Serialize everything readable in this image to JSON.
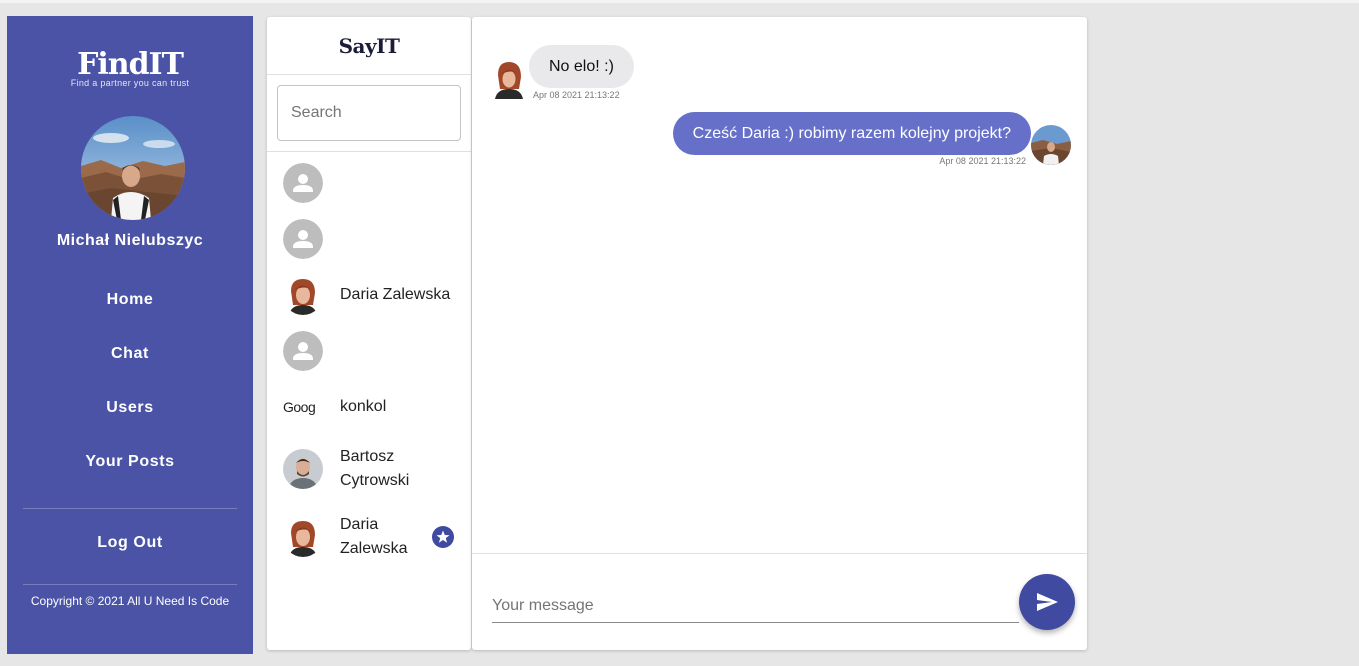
{
  "sidebar": {
    "logo_title": "FindIT",
    "logo_subtitle": "Find a partner you can trust",
    "user_name": "Michał Nielubszyc",
    "nav": [
      {
        "label": "Home"
      },
      {
        "label": "Chat"
      },
      {
        "label": "Users"
      },
      {
        "label": "Your Posts"
      }
    ],
    "logout_label": "Log Out",
    "copyright": "Copyright © 2021 All U Need Is Code",
    "background_color": "#4a53a6"
  },
  "contacts": {
    "app_title": "SayIT",
    "search_placeholder": "Search",
    "items": [
      {
        "name": "",
        "avatar": "default-avatar"
      },
      {
        "name": "",
        "avatar": "default-avatar"
      },
      {
        "name": "Daria Zalewska",
        "avatar": "woman-photo"
      },
      {
        "name": "",
        "avatar": "default-avatar"
      },
      {
        "name": "konkol",
        "avatar": "google-logo",
        "avatar_text": "Goog"
      },
      {
        "name": "Bartosz Cytrowski",
        "avatar": "man-photo"
      },
      {
        "name": "Daria Zalewska",
        "avatar": "woman-photo",
        "starred": true
      }
    ]
  },
  "chat": {
    "messages": [
      {
        "direction": "incoming",
        "text": "No elo! :)",
        "timestamp": "Apr 08 2021 21:13:22"
      },
      {
        "direction": "outgoing",
        "text": "Cześć Daria :) robimy razem kolejny projekt?",
        "timestamp": "Apr 08 2021 21:13:22"
      }
    ],
    "input_placeholder": "Your message",
    "outgoing_bubble_color": "#6670c9",
    "incoming_bubble_color": "#e9e9ec",
    "send_icon": "send-icon"
  }
}
